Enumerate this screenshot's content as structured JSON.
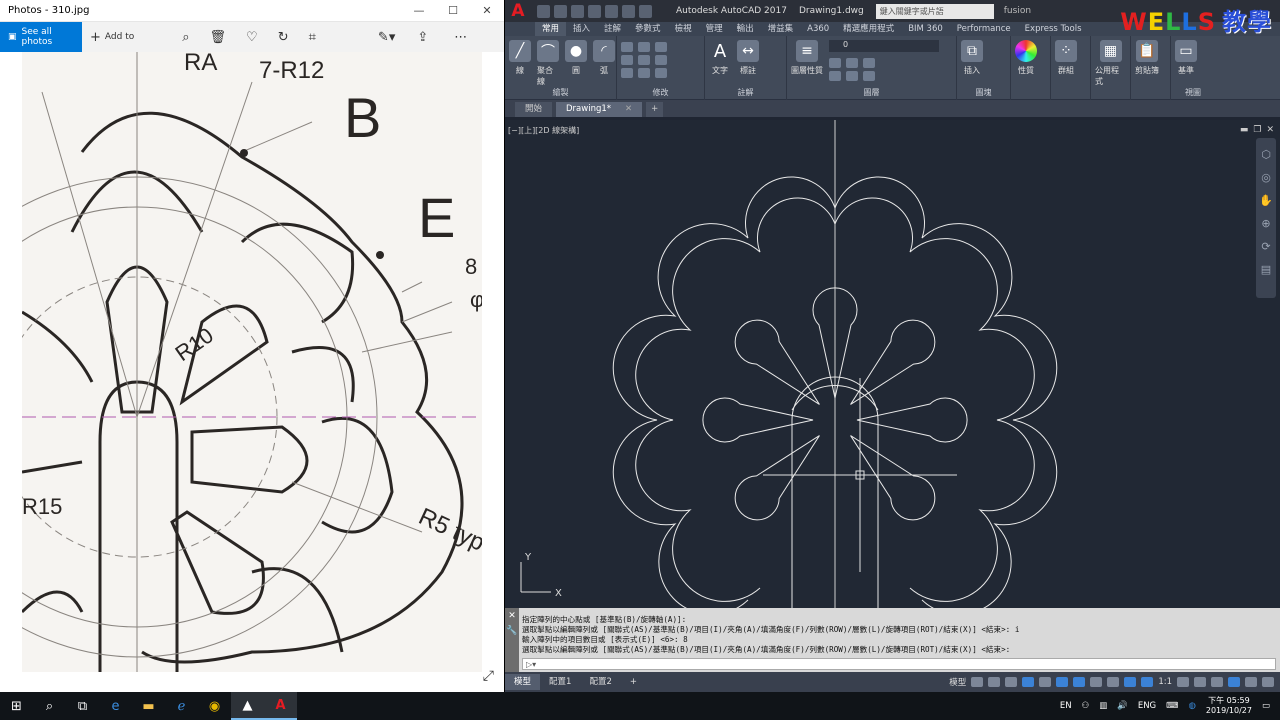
{
  "photos": {
    "title": "Photos - 310.jpg",
    "see_all": "See all photos",
    "add_to": "Add to",
    "drawing_labels": {
      "ra": "RA",
      "r12": "7-R12",
      "b": "B",
      "e": "E",
      "eight": "8",
      "phi": "φ",
      "r10": "R10",
      "r15": "R15",
      "r5": "R5 typ"
    }
  },
  "acad": {
    "logo": "A",
    "app_title": "Autodesk AutoCAD 2017",
    "doc_name": "Drawing1.dwg",
    "search_placeholder": "鍵入關鍵字或片語",
    "user": "fusion",
    "watermark_latin": "WELLS",
    "watermark_cn": "教學",
    "ribbon_tabs": [
      "常用",
      "插入",
      "註解",
      "參數式",
      "檢視",
      "管理",
      "輸出",
      "增益集",
      "A360",
      "精選應用程式",
      "BIM 360",
      "Performance",
      "Express Tools"
    ],
    "ribbon_panels": {
      "draw": {
        "title": "繪製",
        "line": "線",
        "polyline": "聚合線",
        "circle": "圓",
        "arc": "弧"
      },
      "modify": {
        "title": "修改"
      },
      "annotation": {
        "title": "註解",
        "text": "文字",
        "dimension": "標註"
      },
      "layers": {
        "title": "圖層",
        "props": "圖層性質",
        "current": "0"
      },
      "block": {
        "title": "圖塊",
        "insert": "插入"
      },
      "properties": {
        "title": "性質"
      },
      "groups": {
        "title": "群組"
      },
      "utilities": {
        "title": "公用程式"
      },
      "clipboard": {
        "title": "剪貼簿"
      },
      "view": {
        "title": "視圖",
        "base": "基準"
      }
    },
    "doc_tabs": [
      "開始",
      "Drawing1*"
    ],
    "viewport_label": "[−][上][2D 線架構]",
    "ucs": {
      "x": "X",
      "y": "Y"
    },
    "command_history": [
      "指定陣列的中心點或 [基準點(B)/旋轉軸(A)]:",
      "選取掣點以編輯陣列或 [關聯式(AS)/基準點(B)/項目(I)/夾角(A)/填滿角度(F)/列數(ROW)/層數(L)/旋轉項目(ROT)/結束(X)] <結束>: i",
      "輸入陣列中的項目數目或 [表示式(E)] <6>: 8",
      "選取掣點以編輯陣列或 [關聯式(AS)/基準點(B)/項目(I)/夾角(A)/填滿角度(F)/列數(ROW)/層數(L)/旋轉項目(ROT)/結束(X)] <結束>:"
    ],
    "cmd_prompt": "",
    "layout_tabs": [
      "模型",
      "配置1",
      "配置2"
    ],
    "status_model": "模型",
    "status_scale": "1:1"
  },
  "taskbar": {
    "lang": "ENG",
    "ime": "EN",
    "time": "下午 05:59",
    "date": "2019/10/27"
  }
}
